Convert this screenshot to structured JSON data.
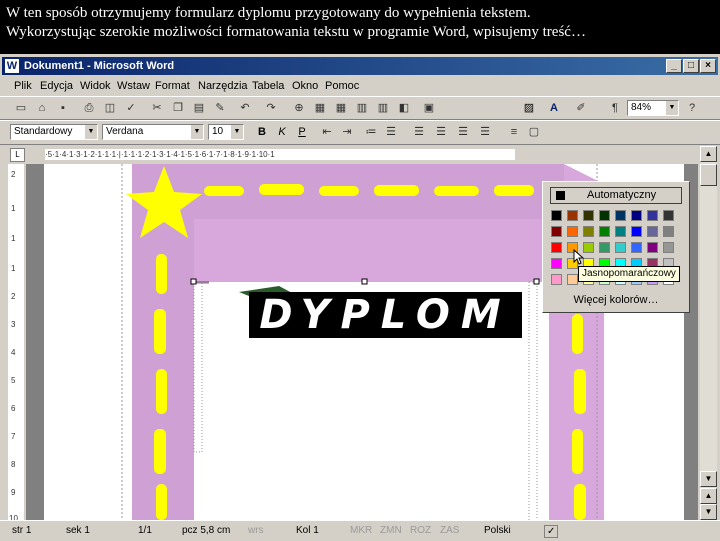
{
  "caption": {
    "line1": "W ten sposób otrzymujemy formularz dyplomu przygotowany do wypełnienia tekstem.",
    "line2": "Wykorzystując szerokie możliwości formatowania tekstu w programie Word, wpisujemy treść…"
  },
  "window": {
    "title": "Dokument1 - Microsoft Word",
    "app_icon": "W",
    "minimize": "_",
    "maximize": "□",
    "close": "×"
  },
  "menu": [
    "Plik",
    "Edycja",
    "Widok",
    "Wstaw",
    "Format",
    "Narzędzia",
    "Tabela",
    "Okno",
    "Pomoc"
  ],
  "toolbar": {
    "zoom": "84%",
    "pilcrow": "¶",
    "font_color_icon": "font-color-icon"
  },
  "format_bar": {
    "style": "Standardowy",
    "font": "Verdana",
    "size": "10",
    "bold": "B",
    "italic": "K",
    "underline": "P"
  },
  "ruler": {
    "marks": "·5·1·4·1·3·1·2·1·1·1·|·1·1·1·2·1·3·1·4·1·5·1·6·1·7·1·8·1·9·1·10·1"
  },
  "vruler": [
    "2",
    "1",
    "1",
    "1",
    "2",
    "3",
    "4",
    "5",
    "6",
    "7",
    "8",
    "9",
    "10"
  ],
  "document": {
    "heading": "DYPLOM"
  },
  "color_popup": {
    "automatic_label": "Automatyczny",
    "more_colors_label": "Więcej kolorów…",
    "tooltip": "Jasnopomarańczowy",
    "colors": [
      "#000000",
      "#993300",
      "#333300",
      "#003300",
      "#003366",
      "#000080",
      "#333399",
      "#333333",
      "#800000",
      "#FF6600",
      "#808000",
      "#008000",
      "#008080",
      "#0000FF",
      "#666699",
      "#808080",
      "#FF0000",
      "#FF9900",
      "#99CC00",
      "#339966",
      "#33CCCC",
      "#3366FF",
      "#800080",
      "#969696",
      "#FF00FF",
      "#FFCC00",
      "#FFFF00",
      "#00FF00",
      "#00FFFF",
      "#00CCFF",
      "#993366",
      "#C0C0C0",
      "#FF99CC",
      "#FFCC99",
      "#FFFF99",
      "#CCFFCC",
      "#CCFFFF",
      "#99CCFF",
      "#CC99FF",
      "#FFFFFF"
    ]
  },
  "status": {
    "page": "str 1",
    "section": "sek 1",
    "pages": "1/1",
    "position": "pcz 5,8 cm",
    "line": "wrs",
    "column": "Kol 1",
    "rec": "MKR",
    "trk": "ZMN",
    "ext": "ROZ",
    "ovr": "ZAS",
    "language": "Polski"
  },
  "colors": {
    "title_bar": "#0a246a",
    "border_purple": "#d8a8dc",
    "border_yellow": "#ffff00"
  }
}
